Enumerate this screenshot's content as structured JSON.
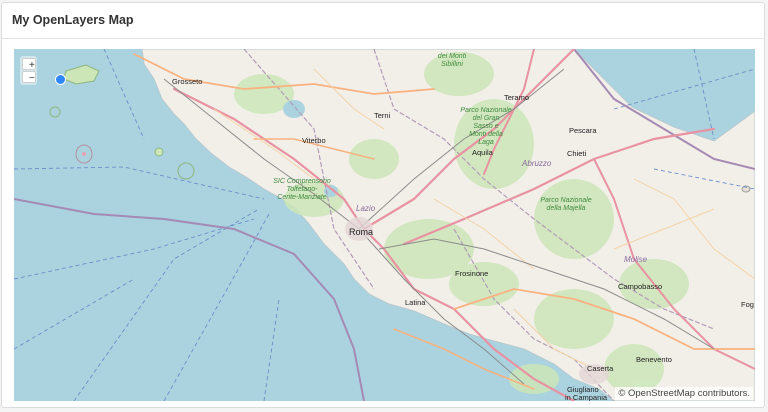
{
  "header": {
    "title": "My OpenLayers Map"
  },
  "map": {
    "zoom_in": "+",
    "zoom_out": "−",
    "attribution": "© OpenStreetMap contributors.",
    "marker_color": "#2f87ff",
    "sea_color": "#aad3df",
    "land_color": "#f2efe9",
    "park_color": "#cde6b8",
    "labels": {
      "grosseto": "Grosseto",
      "terni": "Terni",
      "teramo": "Teramo",
      "pescara": "Pescara",
      "viterbo": "Viterbo",
      "aquila": "Aquila",
      "chieti": "Chieti",
      "abruzzo": "Abruzzo",
      "lazio": "Lazio",
      "roma": "Roma",
      "frosinone": "Frosinone",
      "molise": "Molise",
      "campobasso": "Campobasso",
      "latina": "Latina",
      "benevento": "Benevento",
      "caserta": "Caserta",
      "giugliano_1": "Giugliano",
      "giugliano_2": "in Campania",
      "foggia": "Fog",
      "sibillini_1": "dei Monti",
      "sibillini_2": "Sibillini",
      "gran_sasso_1": "Parco Nazionale",
      "gran_sasso_2": "del Gran",
      "gran_sasso_3": "Sasso e",
      "gran_sasso_4": "Monti della",
      "gran_sasso_5": "Laga",
      "maiella_1": "Parco Nazionale",
      "maiella_2": "della Majella",
      "sic_1": "SIC Comprensorio",
      "sic_2": "Tolfetano-",
      "sic_3": "Cerite-Manziate"
    }
  }
}
